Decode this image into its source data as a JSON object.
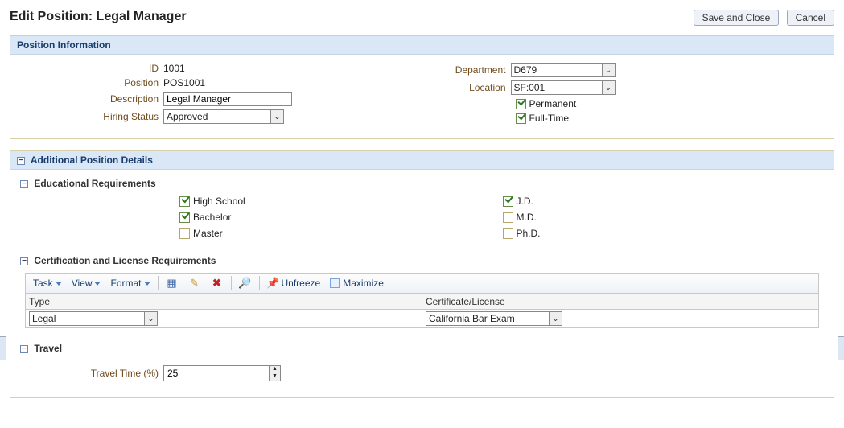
{
  "header": {
    "title": "Edit Position: Legal Manager",
    "save_label": "Save and Close",
    "cancel_label": "Cancel"
  },
  "position_info": {
    "panel_title": "Position Information",
    "id_label": "ID",
    "id_value": "1001",
    "position_label": "Position",
    "position_value": "POS1001",
    "description_label": "Description",
    "description_value": "Legal Manager",
    "hiring_label": "Hiring Status",
    "hiring_value": "Approved",
    "department_label": "Department",
    "department_value": "D679",
    "location_label": "Location",
    "location_value": "SF:001",
    "permanent_label": "Permanent",
    "fulltime_label": "Full-Time"
  },
  "additional": {
    "panel_title": "Additional Position Details",
    "edu": {
      "section_title": "Educational Requirements",
      "highschool": "High School",
      "bachelor": "Bachelor",
      "master": "Master",
      "jd": "J.D.",
      "md": "M.D.",
      "phd": "Ph.D."
    },
    "cert": {
      "section_title": "Certification and License Requirements",
      "toolbar": {
        "task": "Task",
        "view": "View",
        "format": "Format",
        "unfreeze": "Unfreeze",
        "maximize": "Maximize"
      },
      "col_type": "Type",
      "col_cert": "Certificate/License",
      "row_type_value": "Legal",
      "row_cert_value": "California Bar Exam"
    },
    "travel": {
      "section_title": "Travel",
      "time_label": "Travel Time (%)",
      "time_value": "25"
    }
  }
}
